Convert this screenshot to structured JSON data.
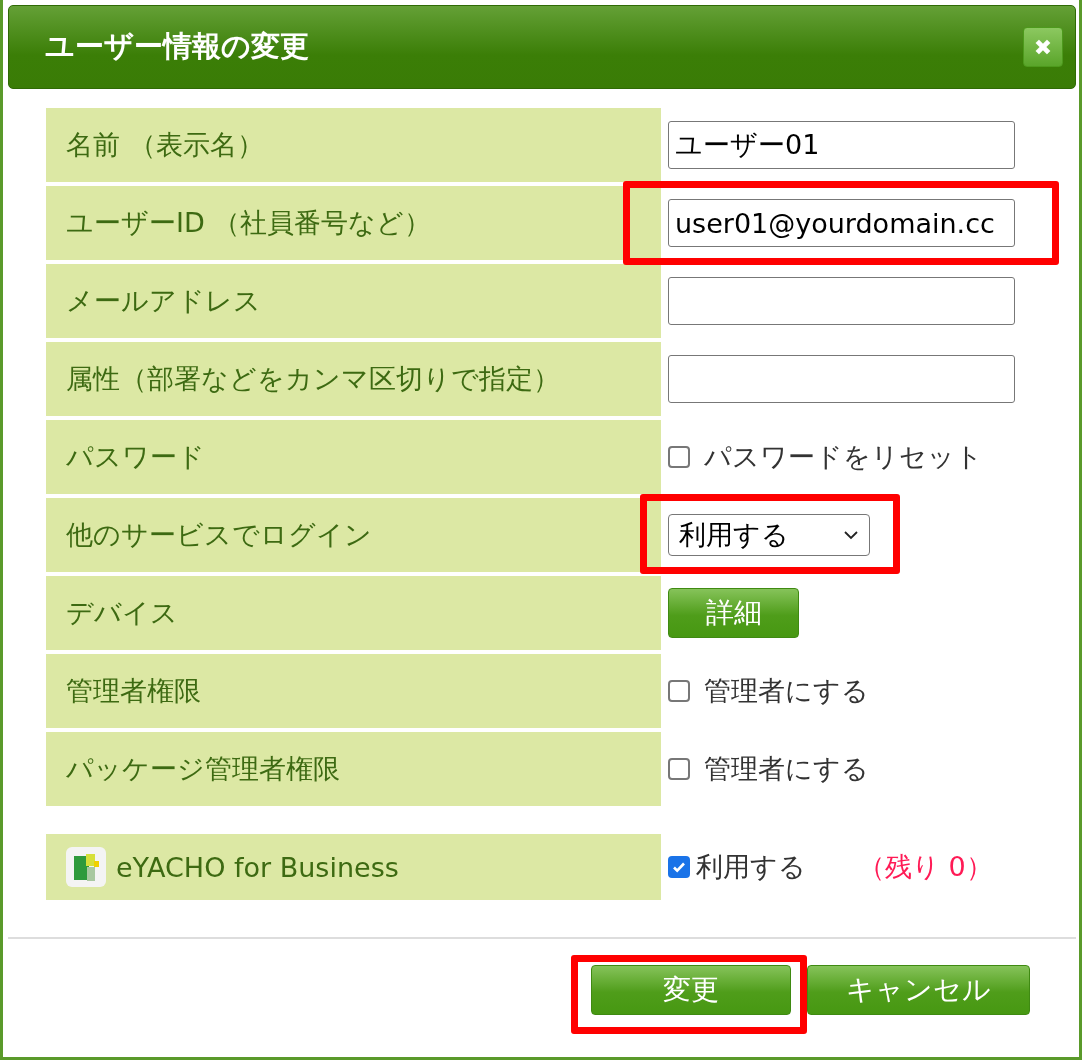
{
  "dialog": {
    "title": "ユーザー情報の変更",
    "close_icon": "✖"
  },
  "rows": [
    {
      "label": "名前 （表示名）",
      "kind": "input",
      "value": "ユーザー01",
      "highlighted": false
    },
    {
      "label": "ユーザーID （社員番号など）",
      "kind": "input",
      "value": "user01@yourdomain.cc",
      "highlighted": true
    },
    {
      "label": "メールアドレス",
      "kind": "input",
      "value": "",
      "highlighted": false
    },
    {
      "label": "属性（部署などをカンマ区切りで指定）",
      "kind": "input",
      "value": "",
      "highlighted": false
    },
    {
      "label": "パスワード",
      "kind": "checkbox",
      "option": "パスワードをリセット",
      "checked": false,
      "highlighted": false
    },
    {
      "label": "他のサービスでログイン",
      "kind": "select",
      "value": "利用する",
      "highlighted": true
    },
    {
      "label": "デバイス",
      "kind": "button",
      "value": "詳細",
      "highlighted": false
    },
    {
      "label": "管理者権限",
      "kind": "checkbox",
      "option": "管理者にする",
      "checked": false,
      "highlighted": false
    },
    {
      "label": "パッケージ管理者権限",
      "kind": "checkbox",
      "option": "管理者にする",
      "checked": false,
      "highlighted": false
    }
  ],
  "license": {
    "label": "eYACHO for Business",
    "option": "利用する",
    "checked": true,
    "remaining": "（残り 0）"
  },
  "buttons": [
    {
      "label": "変更",
      "highlighted": true
    },
    {
      "label": "キャンセル",
      "highlighted": false
    }
  ]
}
